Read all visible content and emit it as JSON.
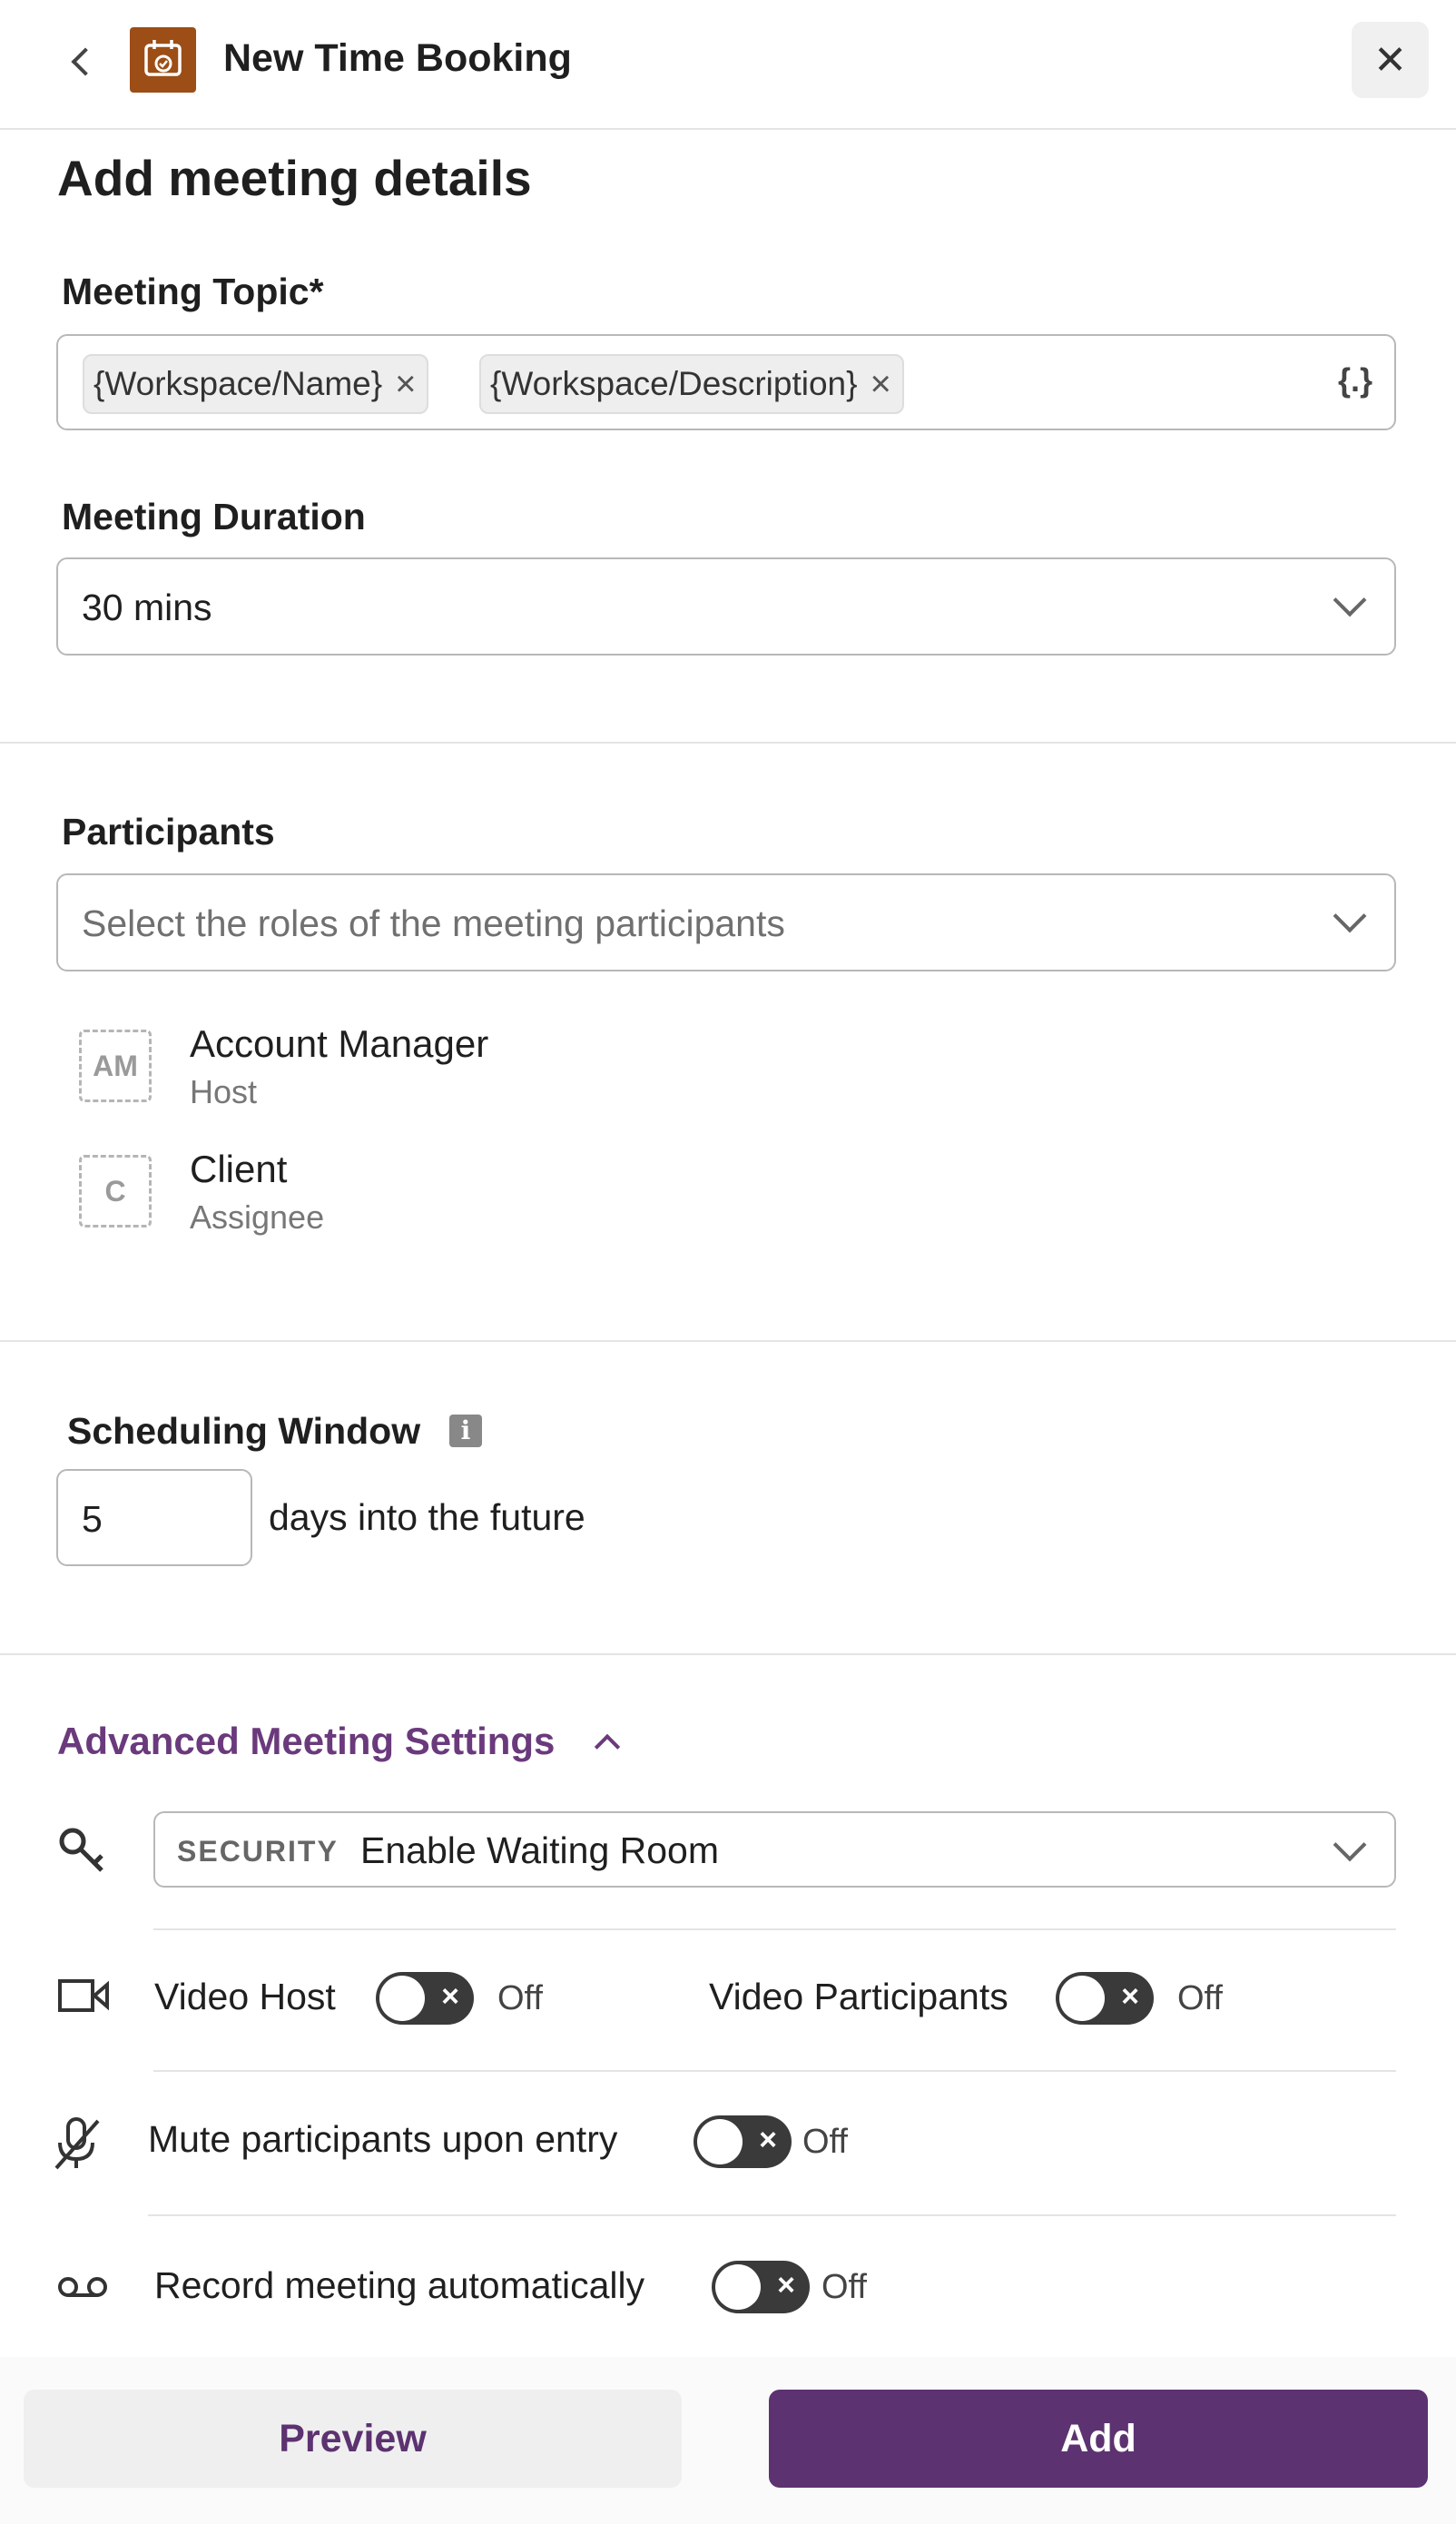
{
  "header": {
    "back_icon": "chevron-left-icon",
    "app_icon": "calendar-check-icon",
    "title": "New Time Booking",
    "close_icon": "close-icon",
    "app_icon_color": "#9c4e16"
  },
  "page_title": "Add meeting details",
  "meeting_topic": {
    "label": "Meeting Topic*",
    "chips": [
      "{Workspace/Name}",
      "{Workspace/Description}"
    ],
    "chip_remove": "×",
    "variable_button": "{.}"
  },
  "meeting_duration": {
    "label": "Meeting Duration",
    "value": "30 mins"
  },
  "participants": {
    "label": "Participants",
    "placeholder": "Select the roles of the meeting participants",
    "items": [
      {
        "initials": "AM",
        "name": "Account Manager",
        "role": "Host"
      },
      {
        "initials": "C",
        "name": "Client",
        "role": "Assignee"
      }
    ]
  },
  "scheduling_window": {
    "label": "Scheduling Window",
    "info_icon": "info-icon",
    "value": "5",
    "suffix": "days into the future"
  },
  "advanced": {
    "title": "Advanced Meeting Settings",
    "accent_color": "#6a3a7c",
    "security": {
      "icon": "key-icon",
      "tag": "SECURITY",
      "value": "Enable Waiting Room"
    },
    "video": {
      "icon": "video-camera-icon",
      "host_label": "Video Host",
      "host_state": "Off",
      "participants_label": "Video Participants",
      "participants_state": "Off"
    },
    "mute": {
      "icon": "microphone-off-icon",
      "label": "Mute participants upon entry",
      "state": "Off"
    },
    "record": {
      "icon": "voicemail-icon",
      "label": "Record meeting automatically",
      "state": "Off"
    }
  },
  "footer": {
    "preview_label": "Preview",
    "add_label": "Add",
    "primary_color": "#5c3270"
  }
}
